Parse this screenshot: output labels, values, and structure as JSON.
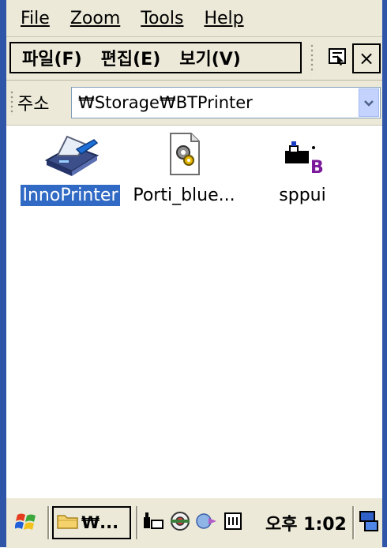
{
  "host_menu": [
    "File",
    "Zoom",
    "Tools",
    "Help"
  ],
  "command_menu": [
    "파일(F)",
    "편집(E)",
    "보기(V)"
  ],
  "toolbar": {
    "properties_icon": "properties-icon",
    "close_label": "×"
  },
  "address_bar": {
    "label": "주소",
    "value": "₩Storage₩BTPrinter"
  },
  "files": [
    {
      "name": "InnoPrinter",
      "icon": "printer-app-icon",
      "selected": true
    },
    {
      "name": "Porti_blue...",
      "icon": "settings-file-icon",
      "selected": false
    },
    {
      "name": "sppui",
      "icon": "sppui-app-icon",
      "selected": false
    }
  ],
  "taskbar": {
    "start_icon": "windows-flag-icon",
    "task_label": "₩...",
    "tray_icons": [
      "sync-icon",
      "network-icon",
      "bluetooth-icon",
      "input-panel-icon"
    ],
    "clock": "오후 1:02",
    "desktop_icon": "desktop-icon"
  },
  "colors": {
    "selection": "#316ac5",
    "frame": "#2f55a8",
    "bar": "#ece9d8"
  }
}
